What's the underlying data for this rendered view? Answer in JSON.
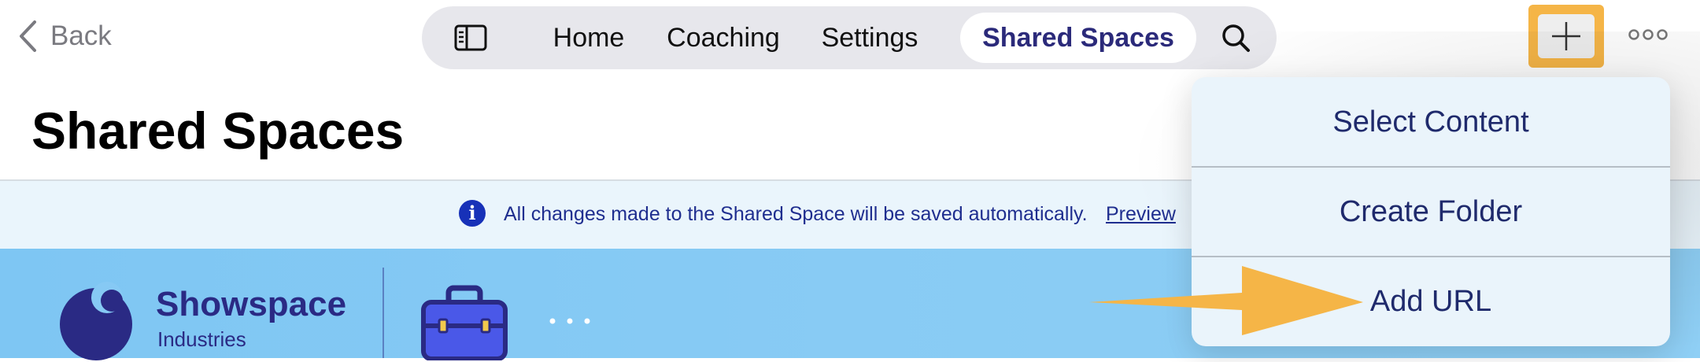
{
  "topbar": {
    "back_label": "Back",
    "nav": {
      "tabs": [
        {
          "label": "Home"
        },
        {
          "label": "Coaching"
        },
        {
          "label": "Settings"
        },
        {
          "label": "Shared Spaces",
          "active": true
        }
      ],
      "icons": [
        "sidebar-toggle-icon",
        "search-icon"
      ]
    },
    "actions": {
      "add_icon": "plus-icon",
      "more_icon": "more-icon",
      "highlight_color": "#F5B547"
    }
  },
  "page": {
    "title": "Shared Spaces"
  },
  "banner": {
    "icon": "i",
    "message": "All changes made to the Shared Space will be saved automatically.",
    "link": "Preview"
  },
  "hero": {
    "brand_name": "Showspace",
    "brand_sub": "Industries",
    "icons": [
      "briefcase-icon",
      "ellipsis-icon"
    ],
    "colors": {
      "background": "#86C9F4",
      "brand": "#2A2A84",
      "briefcase": "#4A58E8"
    }
  },
  "menu": {
    "items": [
      {
        "label": "Select Content"
      },
      {
        "label": "Create Folder"
      },
      {
        "label": "Add URL"
      }
    ]
  },
  "annotation": {
    "arrow_color": "#F5B547"
  }
}
